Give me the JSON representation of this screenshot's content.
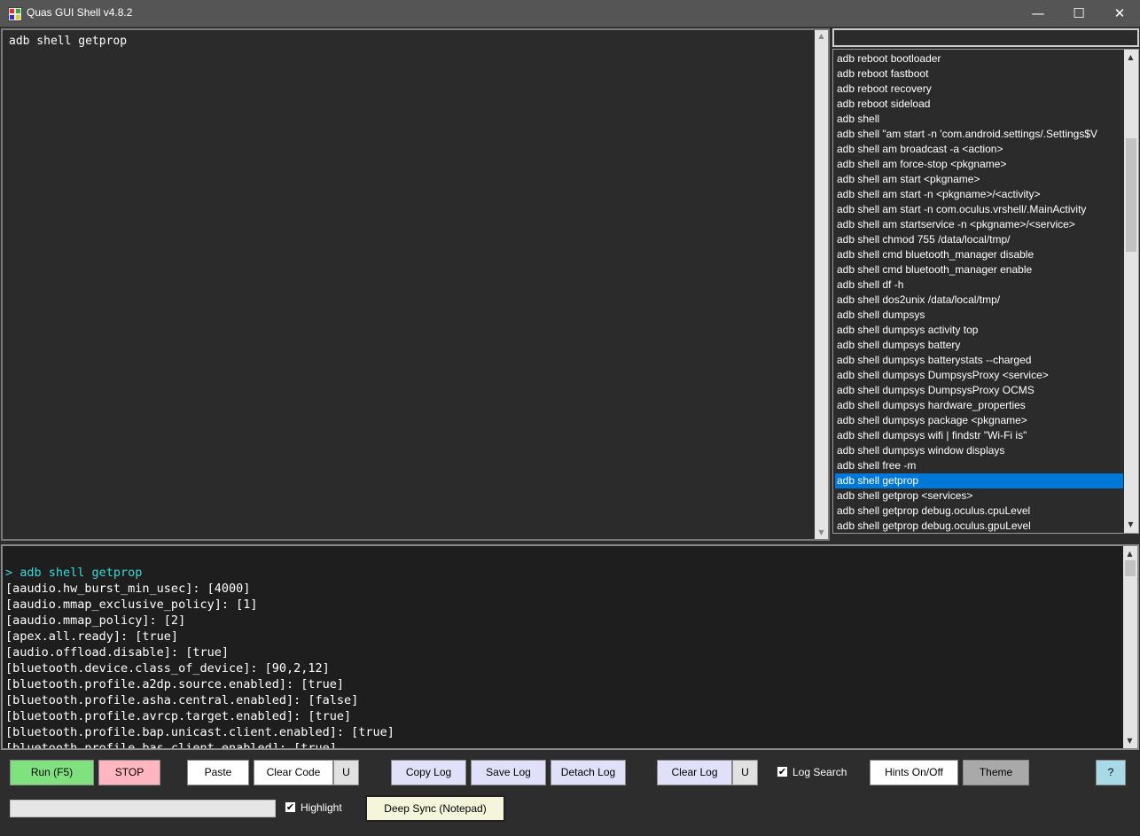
{
  "window": {
    "title": "Quas GUI Shell v4.8.2",
    "minimize": "—",
    "maximize": "☐",
    "close": "✕"
  },
  "editor": {
    "code": "adb shell getprop"
  },
  "hints": {
    "search_value": "",
    "items": [
      "adb reboot bootloader",
      "adb reboot fastboot",
      "adb reboot recovery",
      "adb reboot sideload",
      "adb shell",
      "adb shell \"am start -n 'com.android.settings/.Settings$V",
      "adb shell am broadcast -a <action>",
      "adb shell am force-stop <pkgname>",
      "adb shell am start <pkgname>",
      "adb shell am start -n <pkgname>/<activity>",
      "adb shell am start -n com.oculus.vrshell/.MainActivity",
      "adb shell am startservice -n <pkgname>/<service>",
      "adb shell chmod 755 /data/local/tmp/",
      "adb shell cmd bluetooth_manager disable",
      "adb shell cmd bluetooth_manager enable",
      "adb shell df -h",
      "adb shell dos2unix /data/local/tmp/",
      "adb shell dumpsys",
      "adb shell dumpsys activity top",
      "adb shell dumpsys battery",
      "adb shell dumpsys batterystats --charged",
      "adb shell dumpsys DumpsysProxy <service>",
      "adb shell dumpsys DumpsysProxy OCMS",
      "adb shell dumpsys hardware_properties",
      "adb shell dumpsys package <pkgname>",
      "adb shell dumpsys wifi | findstr \"Wi-Fi is\"",
      "adb shell dumpsys window displays",
      "adb shell free -m",
      "adb shell getprop",
      "adb shell getprop <services>",
      "adb shell getprop debug.oculus.cpuLevel",
      "adb shell getprop debug.oculus.gpuLevel"
    ],
    "selected_index": 28
  },
  "log": {
    "lines": [
      "> adb shell getprop",
      "[aaudio.hw_burst_min_usec]: [4000]",
      "[aaudio.mmap_exclusive_policy]: [1]",
      "[aaudio.mmap_policy]: [2]",
      "[apex.all.ready]: [true]",
      "[audio.offload.disable]: [true]",
      "[bluetooth.device.class_of_device]: [90,2,12]",
      "[bluetooth.profile.a2dp.source.enabled]: [true]",
      "[bluetooth.profile.asha.central.enabled]: [false]",
      "[bluetooth.profile.avrcp.target.enabled]: [true]",
      "[bluetooth.profile.bap.unicast.client.enabled]: [true]",
      "[bluetooth.profile.bas.client.enabled]: [true]"
    ]
  },
  "toolbar": {
    "run": "Run (F5)",
    "stop": "STOP",
    "paste": "Paste",
    "clear_code": "Clear Code",
    "u1": "U",
    "copy_log": "Copy Log",
    "save_log": "Save Log",
    "detach_log": "Detach Log",
    "clear_log": "Clear Log",
    "u2": "U",
    "log_search": "Log Search",
    "hints_toggle": "Hints On/Off",
    "theme": "Theme",
    "help": "?",
    "highlight": "Highlight",
    "deep_sync": "Deep Sync (Notepad)",
    "progress": 0,
    "log_search_checked": true,
    "highlight_checked": true
  },
  "colors": {
    "run": "#7fe27f",
    "stop": "#ffb6c1",
    "theme": "#a9a9a9",
    "help": "#a7d9e6",
    "deep_sync": "#f5f5dc",
    "selection": "#0078d7",
    "log_command": "#3ad7d7"
  }
}
